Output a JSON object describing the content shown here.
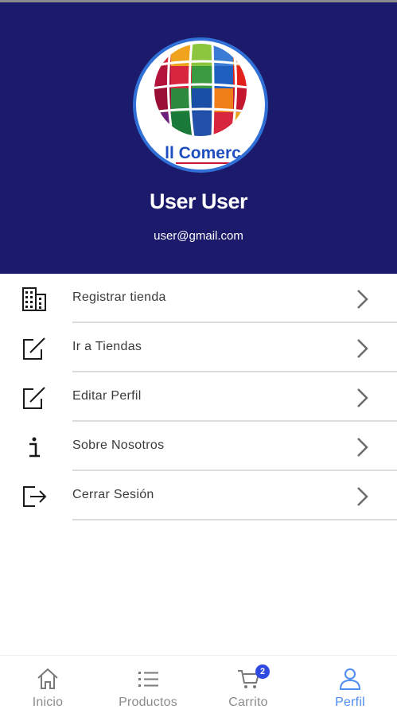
{
  "profile": {
    "name": "User User",
    "email": "user@gmail.com",
    "logo_text": "ll Comerc"
  },
  "menu": [
    {
      "label": "Registrar tienda",
      "icon": "building-icon"
    },
    {
      "label": "Ir a Tiendas",
      "icon": "edit-icon"
    },
    {
      "label": "Editar Perfil",
      "icon": "edit-icon"
    },
    {
      "label": "Sobre Nosotros",
      "icon": "info-icon"
    },
    {
      "label": "Cerrar Sesión",
      "icon": "logout-icon"
    }
  ],
  "bottom_nav": {
    "items": [
      {
        "label": "Inicio",
        "icon": "home-icon"
      },
      {
        "label": "Productos",
        "icon": "list-icon"
      },
      {
        "label": "Carrito",
        "icon": "cart-icon",
        "badge": "2"
      },
      {
        "label": "Perfil",
        "icon": "user-icon",
        "active": true
      }
    ]
  },
  "colors": {
    "header_bg": "#1b1a6b",
    "accent": "#4e8cf0",
    "badge": "#2f4ae0"
  }
}
